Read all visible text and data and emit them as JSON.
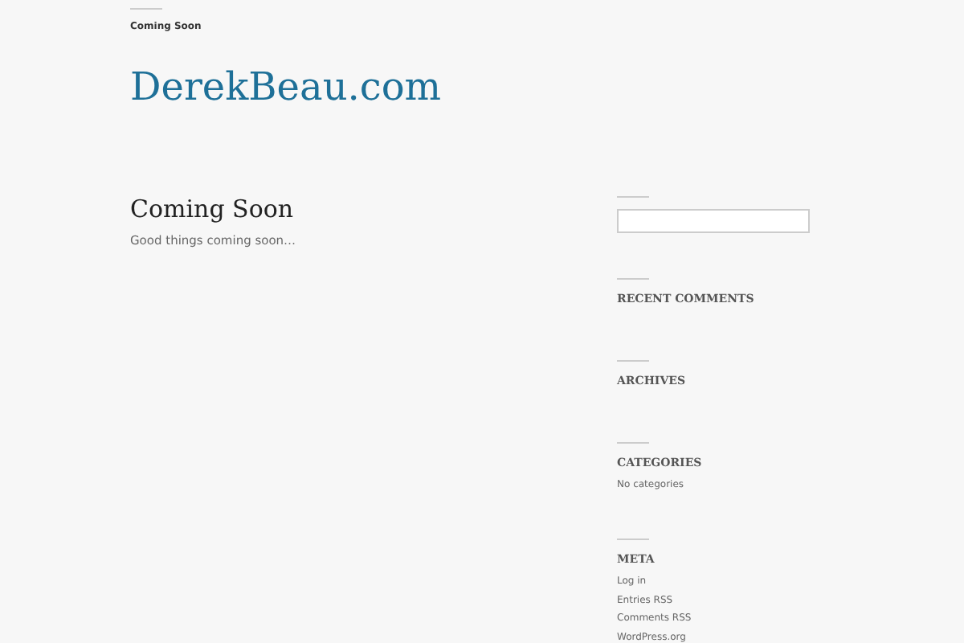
{
  "nav": {
    "items": [
      {
        "label": "Coming Soon"
      }
    ]
  },
  "site_title": "DerekBeau.com",
  "post": {
    "title": "Coming Soon",
    "body": "Good things coming soon…"
  },
  "sidebar": {
    "widgets": [
      {
        "kind": "search"
      },
      {
        "kind": "list",
        "title": "RECENT COMMENTS"
      },
      {
        "kind": "list",
        "title": "ARCHIVES"
      },
      {
        "kind": "list",
        "title": "CATEGORIES",
        "items": [
          "No categories"
        ]
      },
      {
        "kind": "list",
        "title": "META",
        "items": [
          "Log in",
          "Entries RSS",
          "Comments RSS",
          "WordPress.org"
        ]
      }
    ]
  }
}
